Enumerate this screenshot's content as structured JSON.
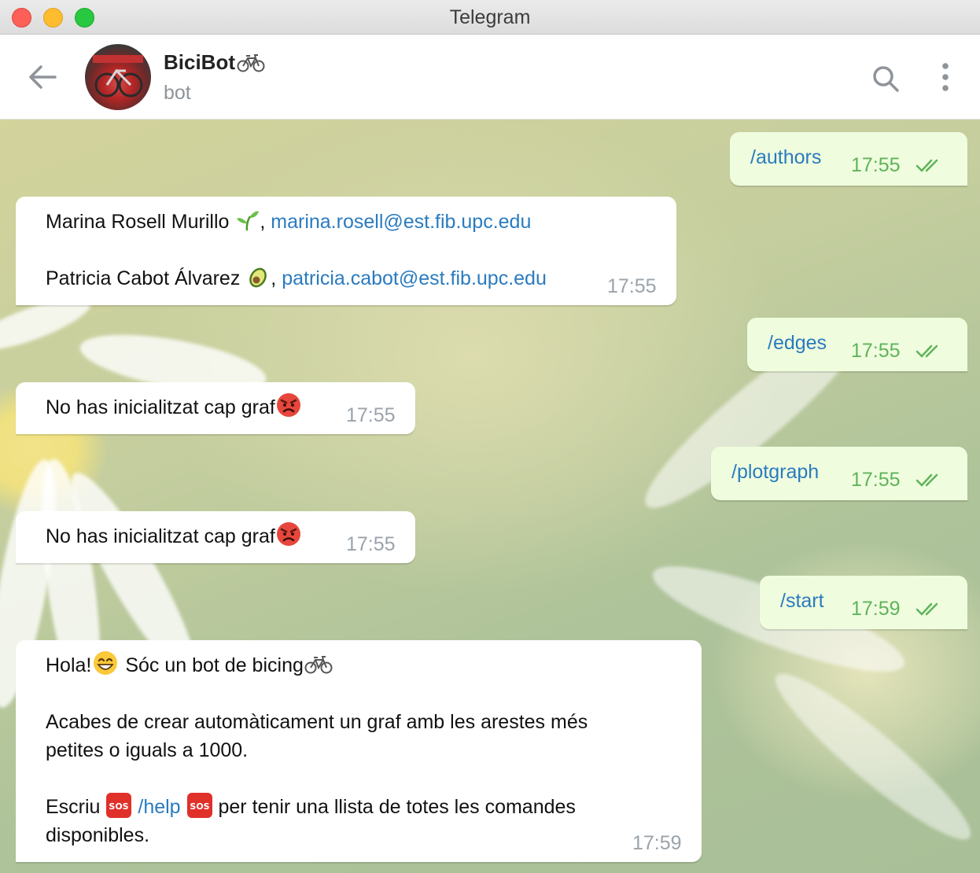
{
  "window": {
    "title": "Telegram"
  },
  "header": {
    "name": "BiciBot",
    "name_emoji": "bicycle",
    "subtitle": "bot"
  },
  "messages": {
    "authors": {
      "text": "/authors",
      "time": "17:55"
    },
    "authors_reply": {
      "l1_name": "Marina Rosell Murillo",
      "l1_sep": ",",
      "l1_email": "marina.rosell@est.fib.upc.edu",
      "l2_name": "Patricia Cabot Álvarez",
      "l2_sep": ",",
      "l2_email": "patricia.cabot@est.fib.upc.edu",
      "time": "17:55"
    },
    "edges": {
      "text": "/edges",
      "time": "17:55"
    },
    "edges_reply": {
      "text": "No has inicialitzat cap graf",
      "time": "17:55"
    },
    "plotgraph": {
      "text": "/plotgraph",
      "time": "17:55"
    },
    "plotgraph_reply": {
      "text": "No has inicialitzat cap graf",
      "time": "17:55"
    },
    "start": {
      "text": "/start",
      "time": "17:59"
    },
    "start_reply": {
      "greet_a": "Hola!",
      "greet_b": "Sóc un bot de bicing",
      "p2_l1": "Acabes de crear automàticament un graf amb les arestes més",
      "p2_l2": "petites o iguals a 1000.",
      "p3_a": "Escriu",
      "p3_cmd": "/help",
      "p3_b": "per tenir una llista de totes les comandes",
      "p3_l2": "disponibles.",
      "time": "17:59"
    }
  },
  "colors": {
    "outgoing": "#effdde",
    "incoming": "#ffffff",
    "link": "#2a7bbf",
    "read_ticks": "#5fb35a"
  }
}
